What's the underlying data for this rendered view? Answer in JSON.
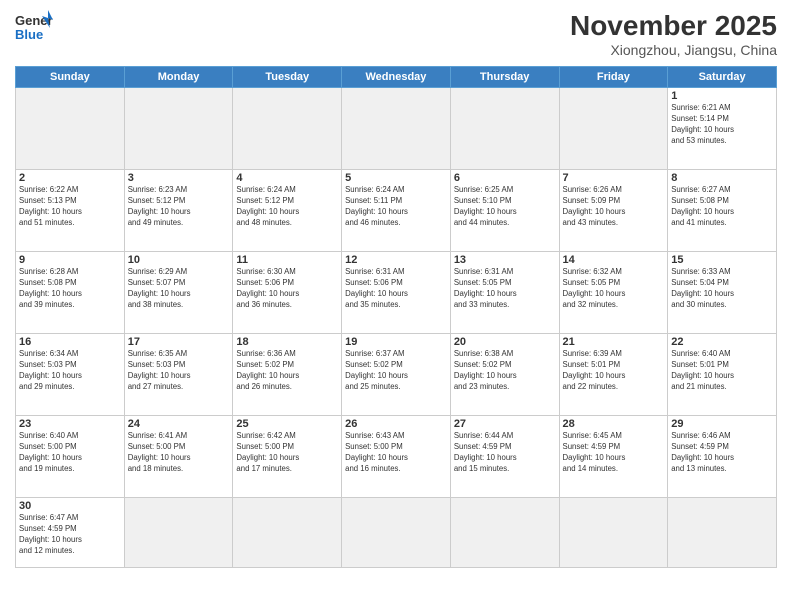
{
  "header": {
    "logo_general": "General",
    "logo_blue": "Blue",
    "month_title": "November 2025",
    "location": "Xiongzhou, Jiangsu, China"
  },
  "weekdays": [
    "Sunday",
    "Monday",
    "Tuesday",
    "Wednesday",
    "Thursday",
    "Friday",
    "Saturday"
  ],
  "days": [
    {
      "day": "",
      "sunrise": "",
      "sunset": "",
      "daylight": "",
      "empty": true
    },
    {
      "day": "",
      "sunrise": "",
      "sunset": "",
      "daylight": "",
      "empty": true
    },
    {
      "day": "",
      "sunrise": "",
      "sunset": "",
      "daylight": "",
      "empty": true
    },
    {
      "day": "",
      "sunrise": "",
      "sunset": "",
      "daylight": "",
      "empty": true
    },
    {
      "day": "",
      "sunrise": "",
      "sunset": "",
      "daylight": "",
      "empty": true
    },
    {
      "day": "",
      "sunrise": "",
      "sunset": "",
      "daylight": "",
      "empty": true
    },
    {
      "day": "1",
      "info": "Sunrise: 6:21 AM\nSunset: 5:14 PM\nDaylight: 10 hours\nand 53 minutes."
    }
  ],
  "week2": [
    {
      "day": "2",
      "info": "Sunrise: 6:22 AM\nSunset: 5:13 PM\nDaylight: 10 hours\nand 51 minutes."
    },
    {
      "day": "3",
      "info": "Sunrise: 6:23 AM\nSunset: 5:12 PM\nDaylight: 10 hours\nand 49 minutes."
    },
    {
      "day": "4",
      "info": "Sunrise: 6:24 AM\nSunset: 5:12 PM\nDaylight: 10 hours\nand 48 minutes."
    },
    {
      "day": "5",
      "info": "Sunrise: 6:24 AM\nSunset: 5:11 PM\nDaylight: 10 hours\nand 46 minutes."
    },
    {
      "day": "6",
      "info": "Sunrise: 6:25 AM\nSunset: 5:10 PM\nDaylight: 10 hours\nand 44 minutes."
    },
    {
      "day": "7",
      "info": "Sunrise: 6:26 AM\nSunset: 5:09 PM\nDaylight: 10 hours\nand 43 minutes."
    },
    {
      "day": "8",
      "info": "Sunrise: 6:27 AM\nSunset: 5:08 PM\nDaylight: 10 hours\nand 41 minutes."
    }
  ],
  "week3": [
    {
      "day": "9",
      "info": "Sunrise: 6:28 AM\nSunset: 5:08 PM\nDaylight: 10 hours\nand 39 minutes."
    },
    {
      "day": "10",
      "info": "Sunrise: 6:29 AM\nSunset: 5:07 PM\nDaylight: 10 hours\nand 38 minutes."
    },
    {
      "day": "11",
      "info": "Sunrise: 6:30 AM\nSunset: 5:06 PM\nDaylight: 10 hours\nand 36 minutes."
    },
    {
      "day": "12",
      "info": "Sunrise: 6:31 AM\nSunset: 5:06 PM\nDaylight: 10 hours\nand 35 minutes."
    },
    {
      "day": "13",
      "info": "Sunrise: 6:31 AM\nSunset: 5:05 PM\nDaylight: 10 hours\nand 33 minutes."
    },
    {
      "day": "14",
      "info": "Sunrise: 6:32 AM\nSunset: 5:05 PM\nDaylight: 10 hours\nand 32 minutes."
    },
    {
      "day": "15",
      "info": "Sunrise: 6:33 AM\nSunset: 5:04 PM\nDaylight: 10 hours\nand 30 minutes."
    }
  ],
  "week4": [
    {
      "day": "16",
      "info": "Sunrise: 6:34 AM\nSunset: 5:03 PM\nDaylight: 10 hours\nand 29 minutes."
    },
    {
      "day": "17",
      "info": "Sunrise: 6:35 AM\nSunset: 5:03 PM\nDaylight: 10 hours\nand 27 minutes."
    },
    {
      "day": "18",
      "info": "Sunrise: 6:36 AM\nSunset: 5:02 PM\nDaylight: 10 hours\nand 26 minutes."
    },
    {
      "day": "19",
      "info": "Sunrise: 6:37 AM\nSunset: 5:02 PM\nDaylight: 10 hours\nand 25 minutes."
    },
    {
      "day": "20",
      "info": "Sunrise: 6:38 AM\nSunset: 5:02 PM\nDaylight: 10 hours\nand 23 minutes."
    },
    {
      "day": "21",
      "info": "Sunrise: 6:39 AM\nSunset: 5:01 PM\nDaylight: 10 hours\nand 22 minutes."
    },
    {
      "day": "22",
      "info": "Sunrise: 6:40 AM\nSunset: 5:01 PM\nDaylight: 10 hours\nand 21 minutes."
    }
  ],
  "week5": [
    {
      "day": "23",
      "info": "Sunrise: 6:40 AM\nSunset: 5:00 PM\nDaylight: 10 hours\nand 19 minutes."
    },
    {
      "day": "24",
      "info": "Sunrise: 6:41 AM\nSunset: 5:00 PM\nDaylight: 10 hours\nand 18 minutes."
    },
    {
      "day": "25",
      "info": "Sunrise: 6:42 AM\nSunset: 5:00 PM\nDaylight: 10 hours\nand 17 minutes."
    },
    {
      "day": "26",
      "info": "Sunrise: 6:43 AM\nSunset: 5:00 PM\nDaylight: 10 hours\nand 16 minutes."
    },
    {
      "day": "27",
      "info": "Sunrise: 6:44 AM\nSunset: 4:59 PM\nDaylight: 10 hours\nand 15 minutes."
    },
    {
      "day": "28",
      "info": "Sunrise: 6:45 AM\nSunset: 4:59 PM\nDaylight: 10 hours\nand 14 minutes."
    },
    {
      "day": "29",
      "info": "Sunrise: 6:46 AM\nSunset: 4:59 PM\nDaylight: 10 hours\nand 13 minutes."
    }
  ],
  "week6": [
    {
      "day": "30",
      "info": "Sunrise: 6:47 AM\nSunset: 4:59 PM\nDaylight: 10 hours\nand 12 minutes."
    },
    {
      "day": "",
      "empty": true
    },
    {
      "day": "",
      "empty": true
    },
    {
      "day": "",
      "empty": true
    },
    {
      "day": "",
      "empty": true
    },
    {
      "day": "",
      "empty": true
    },
    {
      "day": "",
      "empty": true
    }
  ]
}
